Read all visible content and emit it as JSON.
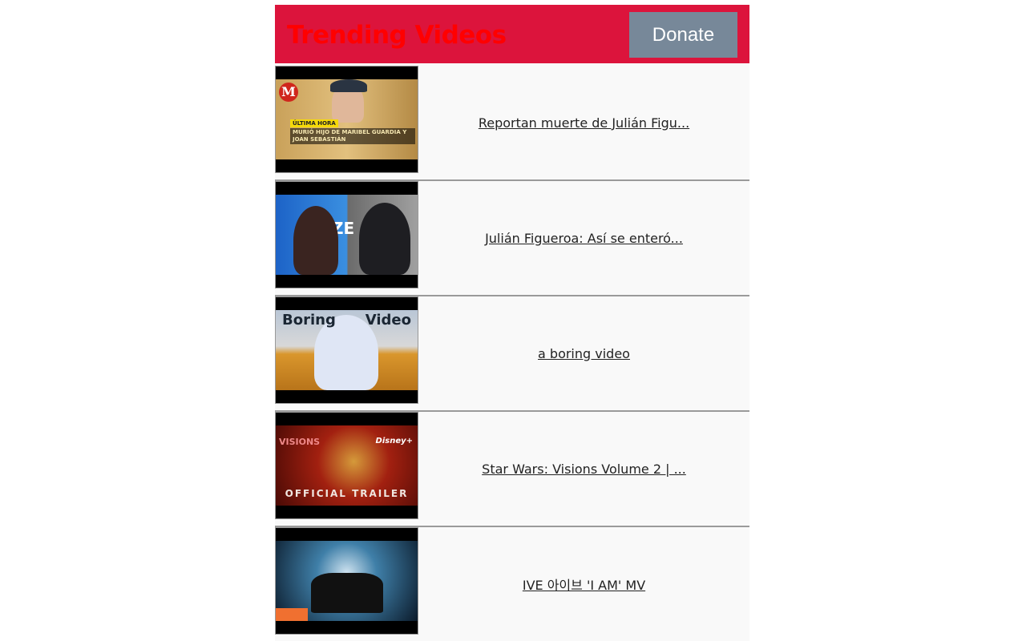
{
  "header": {
    "title": "Trending Videos",
    "donate_label": "Donate",
    "background_color": "#dc143c",
    "title_color": "#ff0000",
    "donate_color": "#778899"
  },
  "videos": [
    {
      "title": "Reportan muerte de Julián Figu...",
      "thumbnail": {
        "caption_top": "ÚLTIMA HORA",
        "caption_bottom": "MURIÓ HIJO DE MARIBEL GUARDIA Y JOAN SEBASTIÁN",
        "logo": "M"
      }
    },
    {
      "title": "Julián Figueroa: Así se enteró...",
      "thumbnail": {
        "caption": "ZE"
      }
    },
    {
      "title": "a boring video",
      "thumbnail": {
        "caption_left": "Boring",
        "caption_right": "Video"
      }
    },
    {
      "title": "Star Wars: Visions Volume 2 | ...",
      "thumbnail": {
        "caption_left": "VISIONS",
        "caption_right": "Disney+",
        "caption_bottom": "OFFICIAL TRAILER"
      }
    },
    {
      "title": "IVE 아이브 'I AM' MV",
      "thumbnail": {}
    }
  ]
}
